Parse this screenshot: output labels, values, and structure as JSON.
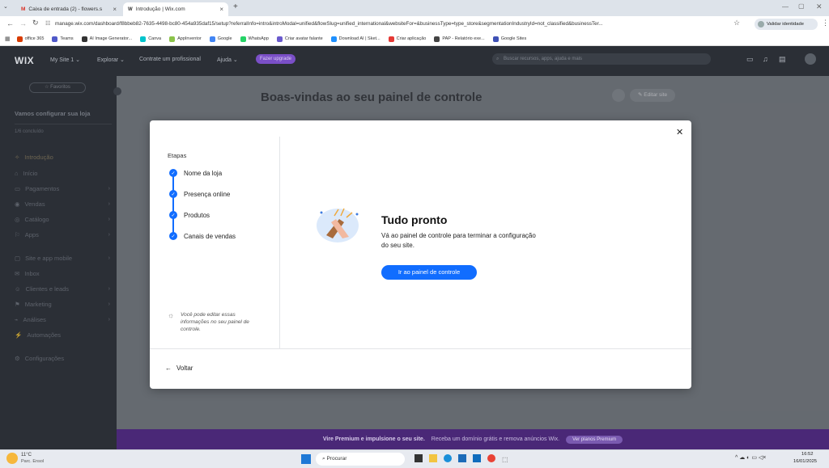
{
  "browser": {
    "tabs": [
      {
        "label": "Caixa de entrada (2) - flowers.s"
      },
      {
        "label": "Introdução | Wix.com"
      }
    ],
    "url": "manage.wix.com/dashboard/f8bbeb82-7635-4498-bc80-454a935daf15/setup?referralInfo=intro&introModal=unified&flowSlug=unified_international&websiteFor=&businessType=type_store&segmentationIndustryId=not_classified&businessTer...",
    "verify_label": "Validar identidade",
    "bookmarks": [
      {
        "label": "office 365",
        "color": "#d83b01"
      },
      {
        "label": "Teams",
        "color": "#5059c9"
      },
      {
        "label": "AI Image Generator...",
        "color": "#333333"
      },
      {
        "label": "Canva",
        "color": "#00c4cc"
      },
      {
        "label": "AppInventor",
        "color": "#8bc34a"
      },
      {
        "label": "Google",
        "color": "#4285f4"
      },
      {
        "label": "WhatsApp",
        "color": "#25d366"
      },
      {
        "label": "Criar avatar falante",
        "color": "#6a5acd"
      },
      {
        "label": "Download AI | Sket...",
        "color": "#1e90ff"
      },
      {
        "label": "Criar aplicação",
        "color": "#e53935"
      },
      {
        "label": "PAP - Relatório exe...",
        "color": "#444444"
      },
      {
        "label": "Google Sites",
        "color": "#3f51b5"
      }
    ]
  },
  "wix": {
    "logo": "WIX",
    "site": "My Site 1",
    "menu": [
      "Explorar",
      "Contrate um profissional",
      "Ajuda"
    ],
    "upgrade": "Fazer upgrade",
    "search_placeholder": "Buscar recursos, apps, ajuda e mais",
    "favorites": "Favoritos",
    "page_title": "Boas-vindas ao seu painel de controle",
    "edit_site": "Editar site",
    "setup_title": "Vamos configurar sua loja",
    "setup_progress": "1/6 concluído",
    "sidebar": [
      "Introdução",
      "Início",
      "Pagamentos",
      "Vendas",
      "Catálogo",
      "Apps",
      "Site e app mobile",
      "Inbox",
      "Clientes e leads",
      "Marketing",
      "Análises",
      "Automações",
      "Configurações"
    ],
    "promo_bold": "Vire Premium e impulsione o seu site.",
    "promo_text": "Receba um domínio grátis e remova anúncios Wix.",
    "promo_button": "Ver planos Premium"
  },
  "modal": {
    "steps_title": "Etapas",
    "steps": [
      "Nome da loja",
      "Presença online",
      "Produtos",
      "Canais de vendas"
    ],
    "tip": "Você pode editar essas informações no seu painel de controle.",
    "title": "Tudo pronto",
    "body": "Vá ao painel de controle para terminar a configuração do seu site.",
    "button": "Ir ao painel de controle",
    "back": "Voltar"
  },
  "taskbar": {
    "temp": "11°C",
    "weather": "Parc. Ensol",
    "search": "Procurar",
    "time": "16:52",
    "date": "16/01/2025"
  }
}
